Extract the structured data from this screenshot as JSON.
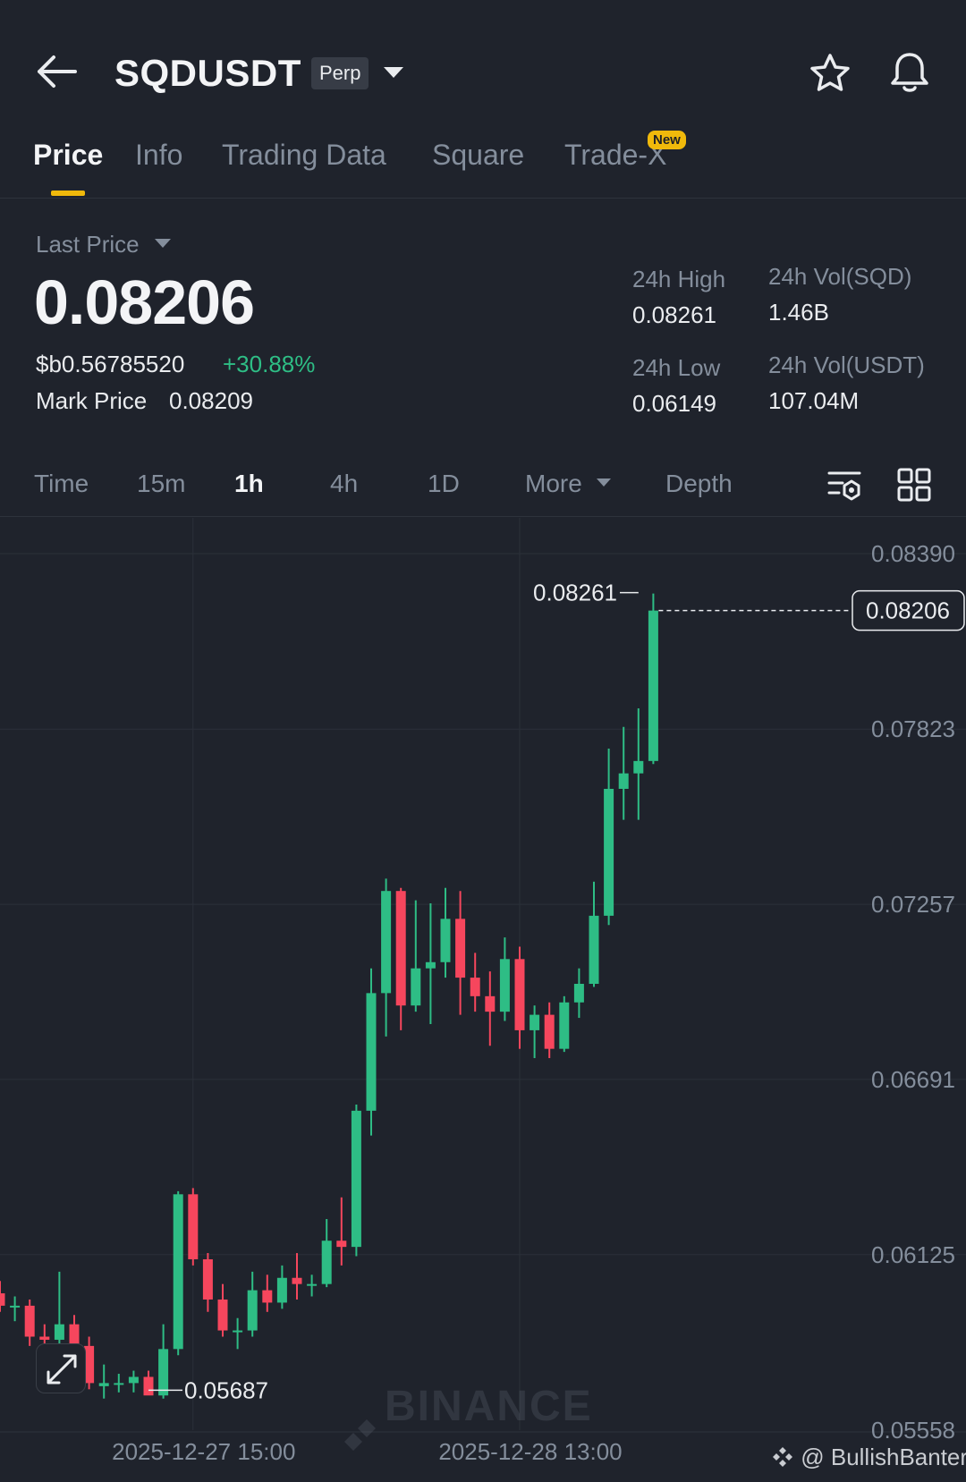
{
  "header": {
    "symbol": "SQDUSDT",
    "contract_type": "Perp",
    "icons": [
      "back-arrow-icon",
      "chevron-down-icon",
      "star-icon",
      "bell-icon"
    ]
  },
  "tabs": [
    {
      "label": "Price",
      "active": true
    },
    {
      "label": "Info"
    },
    {
      "label": "Trading Data"
    },
    {
      "label": "Square"
    },
    {
      "label": "Trade-X",
      "badge": "New"
    }
  ],
  "price": {
    "last_price_label": "Last Price",
    "last_price": "0.08206",
    "fiat_price": "$b0.56785520",
    "change_pct": "+30.88%",
    "mark_price_label": "Mark Price",
    "mark_price": "0.08209"
  },
  "stats": {
    "high_label": "24h High",
    "high": "0.08261",
    "low_label": "24h Low",
    "low": "0.06149",
    "vol_base_label": "24h Vol(SQD)",
    "vol_base": "1.46B",
    "vol_quote_label": "24h Vol(USDT)",
    "vol_quote": "107.04M"
  },
  "intervals": [
    {
      "label": "Time"
    },
    {
      "label": "15m"
    },
    {
      "label": "1h",
      "active": true
    },
    {
      "label": "4h"
    },
    {
      "label": "1D"
    },
    {
      "label": "More"
    },
    {
      "label": "Depth"
    }
  ],
  "colors": {
    "up": "#2ebd85",
    "down": "#f6465d",
    "accent": "#f0b90b",
    "background": "#1f232c"
  },
  "chart_data": {
    "type": "candlestick",
    "y_ticks": [
      "0.08390",
      "0.07823",
      "0.07257",
      "0.06691",
      "0.06125",
      "0.05558"
    ],
    "ylim": [
      0.0554,
      0.0855
    ],
    "x_ticks": [
      {
        "label": "2025-12-27 15:00",
        "index": 13
      },
      {
        "label": "2025-12-28 13:00",
        "index": 35
      }
    ],
    "current_price_label": "0.08206",
    "current_price": 0.08206,
    "high_marker": {
      "label": "0.08261",
      "index": 43,
      "value": 0.08261
    },
    "low_marker": {
      "label": "0.05687",
      "index": 10,
      "value": 0.05687
    },
    "watermark": "BINANCE",
    "candles": [
      {
        "o": 0.06,
        "h": 0.0604,
        "l": 0.0594,
        "c": 0.0596
      },
      {
        "o": 0.0596,
        "h": 0.0599,
        "l": 0.0591,
        "c": 0.0596
      },
      {
        "o": 0.0596,
        "h": 0.0598,
        "l": 0.0583,
        "c": 0.0586
      },
      {
        "o": 0.0586,
        "h": 0.059,
        "l": 0.0579,
        "c": 0.0585
      },
      {
        "o": 0.0585,
        "h": 0.0607,
        "l": 0.058,
        "c": 0.059
      },
      {
        "o": 0.059,
        "h": 0.0593,
        "l": 0.0582,
        "c": 0.0583
      },
      {
        "o": 0.0583,
        "h": 0.0586,
        "l": 0.0569,
        "c": 0.0571
      },
      {
        "o": 0.057,
        "h": 0.0577,
        "l": 0.0566,
        "c": 0.0571
      },
      {
        "o": 0.0571,
        "h": 0.0574,
        "l": 0.0568,
        "c": 0.0571
      },
      {
        "o": 0.0571,
        "h": 0.0575,
        "l": 0.0568,
        "c": 0.0573
      },
      {
        "o": 0.0573,
        "h": 0.0575,
        "l": 0.05687,
        "c": 0.0567
      },
      {
        "o": 0.0567,
        "h": 0.059,
        "l": 0.0566,
        "c": 0.0582
      },
      {
        "o": 0.0582,
        "h": 0.0633,
        "l": 0.058,
        "c": 0.0632
      },
      {
        "o": 0.0632,
        "h": 0.0634,
        "l": 0.0609,
        "c": 0.0611
      },
      {
        "o": 0.0611,
        "h": 0.0613,
        "l": 0.0594,
        "c": 0.0598
      },
      {
        "o": 0.0598,
        "h": 0.0603,
        "l": 0.0586,
        "c": 0.0588
      },
      {
        "o": 0.0588,
        "h": 0.0592,
        "l": 0.0582,
        "c": 0.0588
      },
      {
        "o": 0.0588,
        "h": 0.0607,
        "l": 0.0586,
        "c": 0.0601
      },
      {
        "o": 0.0601,
        "h": 0.0606,
        "l": 0.0594,
        "c": 0.0597
      },
      {
        "o": 0.0597,
        "h": 0.0609,
        "l": 0.0595,
        "c": 0.0605
      },
      {
        "o": 0.0605,
        "h": 0.0613,
        "l": 0.0598,
        "c": 0.0603
      },
      {
        "o": 0.0603,
        "h": 0.0606,
        "l": 0.0599,
        "c": 0.0603
      },
      {
        "o": 0.0603,
        "h": 0.0624,
        "l": 0.0602,
        "c": 0.0617
      },
      {
        "o": 0.0617,
        "h": 0.0631,
        "l": 0.0609,
        "c": 0.0615
      },
      {
        "o": 0.0615,
        "h": 0.0661,
        "l": 0.0612,
        "c": 0.0659
      },
      {
        "o": 0.0659,
        "h": 0.0705,
        "l": 0.0651,
        "c": 0.0697
      },
      {
        "o": 0.0697,
        "h": 0.0734,
        "l": 0.0683,
        "c": 0.073
      },
      {
        "o": 0.073,
        "h": 0.0731,
        "l": 0.0685,
        "c": 0.0693
      },
      {
        "o": 0.0693,
        "h": 0.0727,
        "l": 0.0691,
        "c": 0.0705
      },
      {
        "o": 0.0705,
        "h": 0.0726,
        "l": 0.0687,
        "c": 0.0707
      },
      {
        "o": 0.0707,
        "h": 0.0731,
        "l": 0.0702,
        "c": 0.0721
      },
      {
        "o": 0.0721,
        "h": 0.073,
        "l": 0.069,
        "c": 0.0702
      },
      {
        "o": 0.0702,
        "h": 0.071,
        "l": 0.0691,
        "c": 0.0696
      },
      {
        "o": 0.0696,
        "h": 0.0704,
        "l": 0.068,
        "c": 0.0691
      },
      {
        "o": 0.0691,
        "h": 0.0715,
        "l": 0.0688,
        "c": 0.0708
      },
      {
        "o": 0.0708,
        "h": 0.0712,
        "l": 0.0679,
        "c": 0.0685
      },
      {
        "o": 0.0685,
        "h": 0.0693,
        "l": 0.0676,
        "c": 0.069
      },
      {
        "o": 0.069,
        "h": 0.0694,
        "l": 0.0676,
        "c": 0.0679
      },
      {
        "o": 0.0679,
        "h": 0.0696,
        "l": 0.0678,
        "c": 0.0694
      },
      {
        "o": 0.0694,
        "h": 0.0705,
        "l": 0.0689,
        "c": 0.07
      },
      {
        "o": 0.07,
        "h": 0.0733,
        "l": 0.0699,
        "c": 0.0722
      },
      {
        "o": 0.0722,
        "h": 0.0776,
        "l": 0.0719,
        "c": 0.0763
      },
      {
        "o": 0.0763,
        "h": 0.0783,
        "l": 0.0753,
        "c": 0.0768
      },
      {
        "o": 0.0768,
        "h": 0.0789,
        "l": 0.0753,
        "c": 0.0772
      },
      {
        "o": 0.0772,
        "h": 0.08261,
        "l": 0.0771,
        "c": 0.08206
      }
    ]
  },
  "watermark_text": "@ BullishBanter"
}
